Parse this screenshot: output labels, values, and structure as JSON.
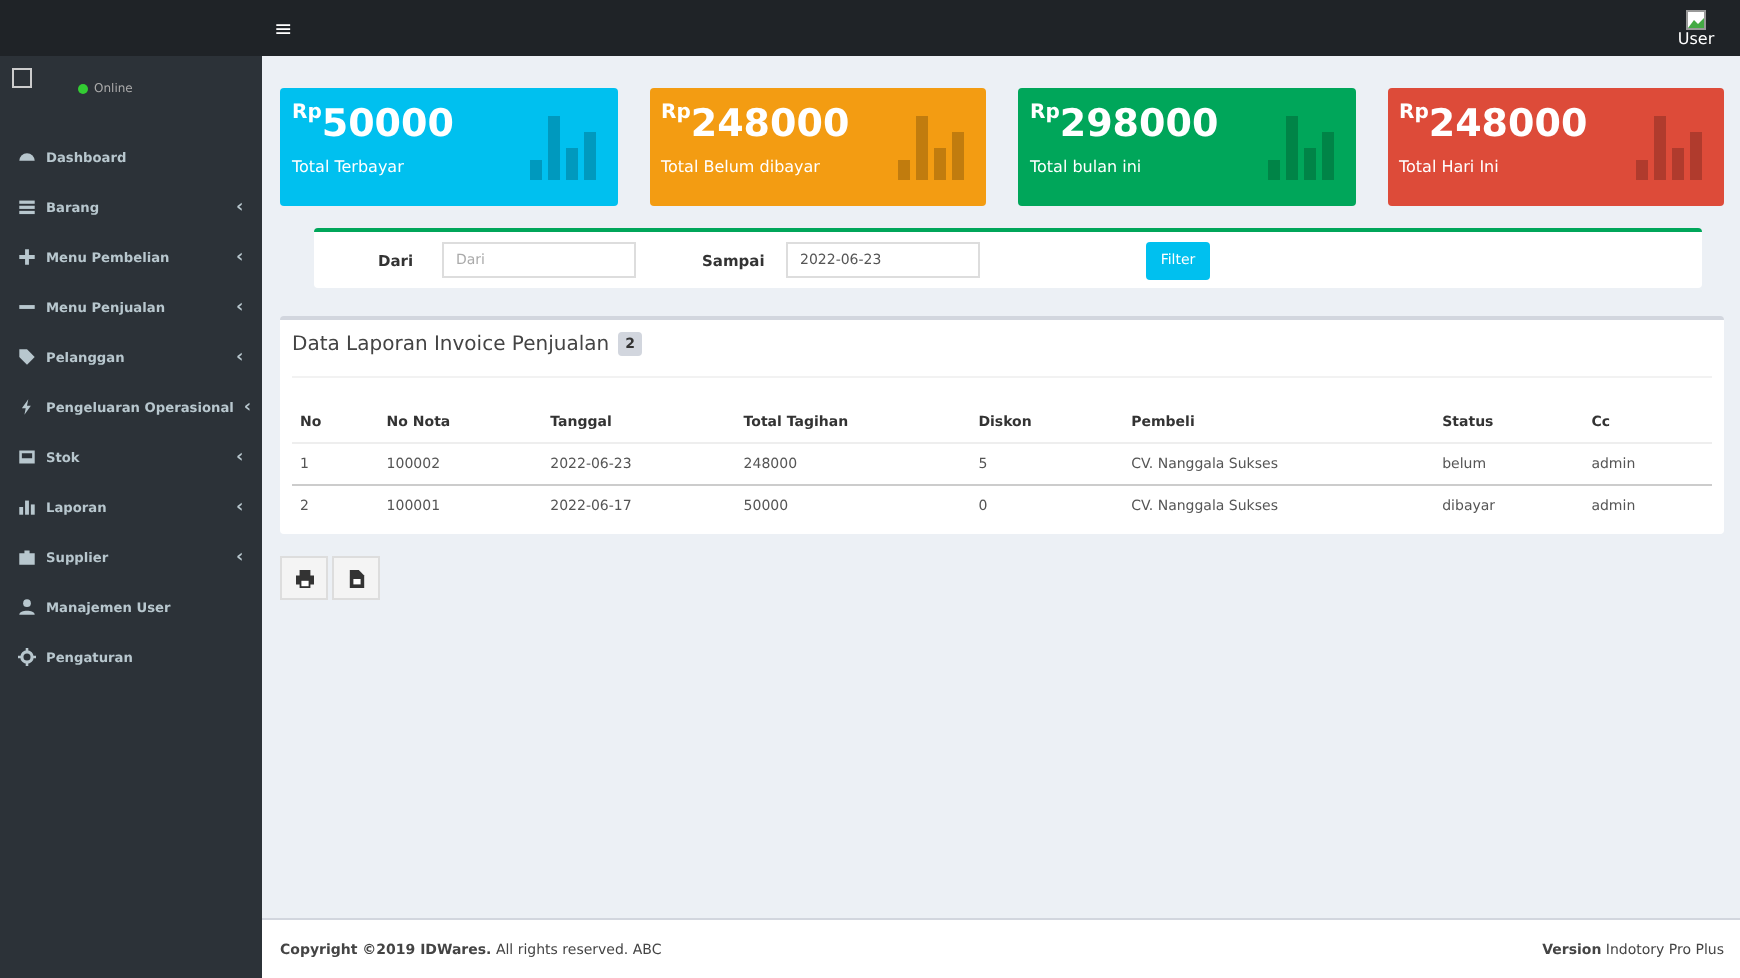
{
  "navbar": {
    "menu_toggle": "≡",
    "user_image_alt": "User"
  },
  "sidebar": {
    "user_status": "Online",
    "items": [
      {
        "label": "Dashboard"
      },
      {
        "label": "Barang",
        "caret": "‹"
      },
      {
        "label": "Menu Pembelian",
        "caret": "‹"
      },
      {
        "label": "Menu Penjualan",
        "caret": "‹"
      },
      {
        "label": "Pelanggan",
        "caret": "‹"
      },
      {
        "label": "Pengeluaran Operasional",
        "caret": "‹"
      },
      {
        "label": "Stok",
        "caret": "‹"
      },
      {
        "label": "Laporan",
        "caret": "‹"
      },
      {
        "label": "Supplier",
        "caret": "‹"
      },
      {
        "label": "Manajemen User"
      },
      {
        "label": "Pengaturan"
      }
    ]
  },
  "stat_cards": [
    {
      "currency": "Rp",
      "value": "50000",
      "label": "Total Terbayar",
      "color": "#00c0ef"
    },
    {
      "currency": "Rp",
      "value": "248000",
      "label": "Total Belum dibayar",
      "color": "#f39c12"
    },
    {
      "currency": "Rp",
      "value": "298000",
      "label": "Total bulan ini",
      "color": "#00a65a"
    },
    {
      "currency": "Rp",
      "value": "248000",
      "label": "Total Hari Ini",
      "color": "#dd4b39"
    }
  ],
  "filter": {
    "from_label": "Dari",
    "from_placeholder": "Dari",
    "to_label": "Sampai",
    "to_value": "2022-06-23",
    "button": "Filter"
  },
  "report": {
    "title": "Data Laporan Invoice Penjualan",
    "count": "2",
    "table": {
      "columns": [
        "No",
        "No Nota",
        "Tanggal",
        "Total Tagihan",
        "Diskon",
        "Pembeli",
        "Status",
        "Cc"
      ],
      "rows": [
        [
          "1",
          "100002",
          "2022-06-23",
          "248000",
          "5",
          "CV. Nanggala Sukses",
          "belum",
          "admin"
        ],
        [
          "2",
          "100001",
          "2022-06-17",
          "50000",
          "0",
          "CV. Nanggala Sukses",
          "dibayar",
          "admin"
        ]
      ]
    }
  },
  "footer": {
    "copyright": "**Copyright ©2019 IDWares.** All rights reserved. ABC",
    "version": "**Version** Indotory Pro Plus"
  }
}
